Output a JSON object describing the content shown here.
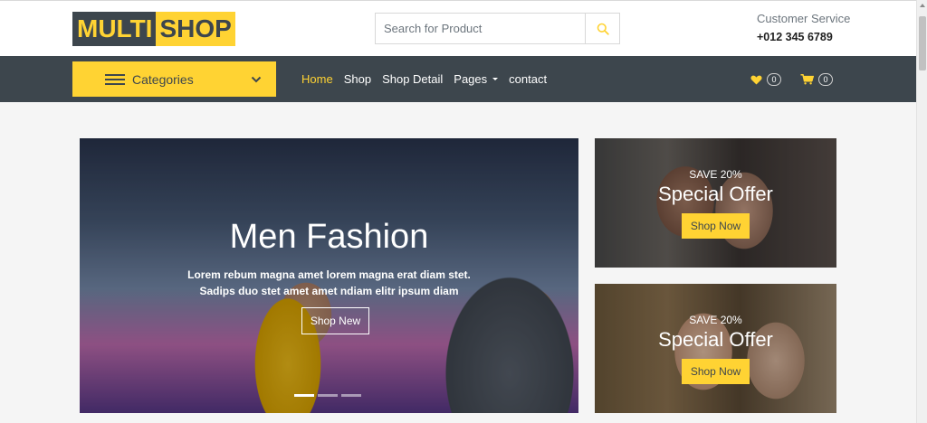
{
  "brand": {
    "part1": "MULTI",
    "part2": "SHOP"
  },
  "search": {
    "placeholder": "Search for Product",
    "icon": "search-icon"
  },
  "customer_service": {
    "label": "Customer Service",
    "phone": "+012 345 6789"
  },
  "categories": {
    "label": "Categories",
    "icon": "hamburger-icon",
    "chevron": "chevron-down-icon"
  },
  "nav": {
    "items": [
      {
        "label": "Home",
        "active": true
      },
      {
        "label": "Shop",
        "active": false
      },
      {
        "label": "Shop Detail",
        "active": false
      },
      {
        "label": "Pages",
        "active": false,
        "dropdown": true
      },
      {
        "label": "contact",
        "active": false
      }
    ],
    "wishlist_count": "0",
    "cart_count": "0"
  },
  "hero": {
    "title": "Men Fashion",
    "desc": "Lorem rebum magna amet lorem magna erat diam stet. Sadips duo stet amet amet ndiam elitr ipsum diam",
    "button": "Shop New",
    "active_slide": 1,
    "slides": 3
  },
  "offers": [
    {
      "save": "SAVE 20%",
      "title": "Special Offer",
      "button": "Shop Now"
    },
    {
      "save": "SAVE 20%",
      "title": "Special Offer",
      "button": "Shop Now"
    }
  ],
  "colors": {
    "accent": "#ffd333",
    "dark": "#3d464d",
    "background": "#f5f5f5"
  }
}
